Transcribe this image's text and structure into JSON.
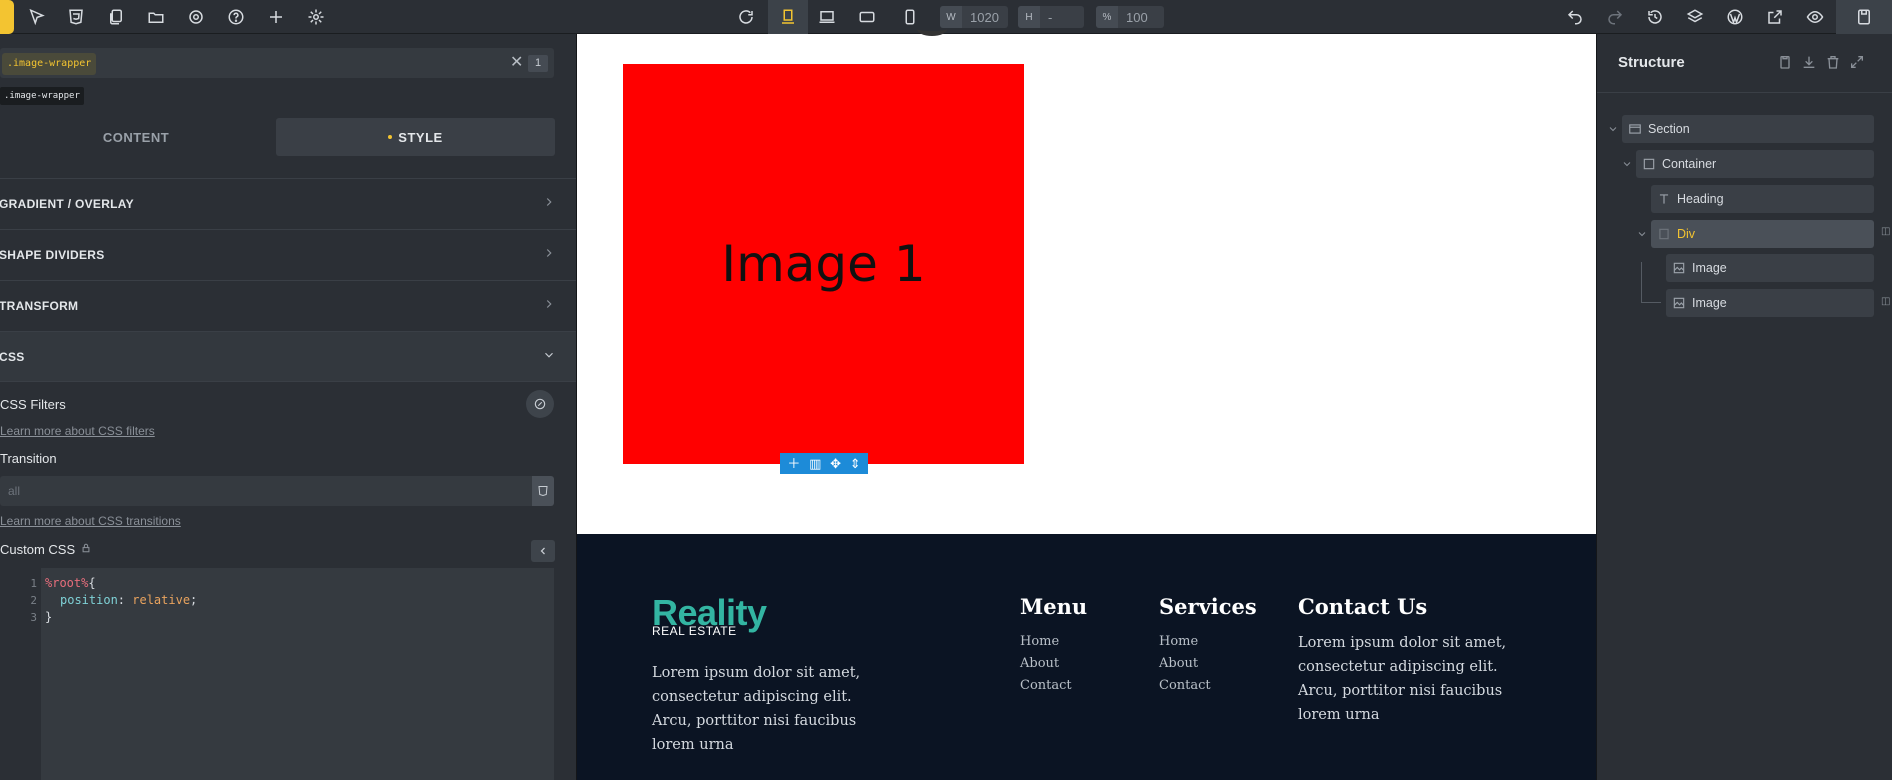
{
  "toolbar": {
    "width_label": "W",
    "width_value": "1020",
    "height_label": "H",
    "height_value": "-",
    "zoom_label": "%",
    "zoom_value": "100"
  },
  "left_panel": {
    "selector_chip": ".image-wrapper",
    "selector_count": "1",
    "selector_tooltip": ".image-wrapper",
    "tab_content": "CONTENT",
    "tab_style": "STYLE",
    "sections": [
      {
        "label": "GRADIENT / OVERLAY"
      },
      {
        "label": "SHAPE DIVIDERS"
      },
      {
        "label": "TRANSFORM"
      },
      {
        "label": "CSS"
      }
    ],
    "css_filters_label": "CSS Filters",
    "css_filters_link": "Learn more about CSS filters",
    "transition_label": "Transition",
    "transition_placeholder": "all",
    "transition_link": "Learn more about CSS transitions",
    "custom_css_label": "Custom CSS",
    "code": {
      "line_numbers": [
        "1",
        "2",
        "3"
      ],
      "line1_selector": "%root%",
      "line1_brace": "{",
      "line2_prop": "position",
      "line2_colon": ": ",
      "line2_value": "relative",
      "line2_semicolon": ";",
      "line3": "}"
    }
  },
  "canvas": {
    "image_label": "Image 1",
    "image_color": "#ff0000",
    "footer": {
      "logo_name": "Reality",
      "logo_sub": "REAL ESTATE",
      "about_text": "Lorem ipsum dolor sit amet, consectetur adipiscing elit. Arcu, porttitor nisi faucibus lorem urna",
      "menu_title": "Menu",
      "menu_items": [
        "Home",
        "About",
        "Contact"
      ],
      "services_title": "Services",
      "services_items": [
        "Home",
        "About",
        "Contact"
      ],
      "contact_title": "Contact Us",
      "contact_text": "Lorem ipsum dolor sit amet, consectetur adipiscing elit. Arcu, porttitor nisi faucibus lorem urna"
    }
  },
  "structure": {
    "title": "Structure",
    "nodes": [
      {
        "label": "Section",
        "icon": "section-icon"
      },
      {
        "label": "Container",
        "icon": "container-icon"
      },
      {
        "label": "Heading",
        "icon": "heading-icon"
      },
      {
        "label": "Div",
        "icon": "div-icon"
      },
      {
        "label": "Image",
        "icon": "image-icon"
      },
      {
        "label": "Image",
        "icon": "image-icon"
      }
    ]
  },
  "colors": {
    "accent": "#f3c431",
    "panel_bg": "#2b2f35",
    "footer_bg": "#0b1423",
    "logo_teal": "#33b5a2",
    "toolbar_blue": "#1d8bd8"
  }
}
